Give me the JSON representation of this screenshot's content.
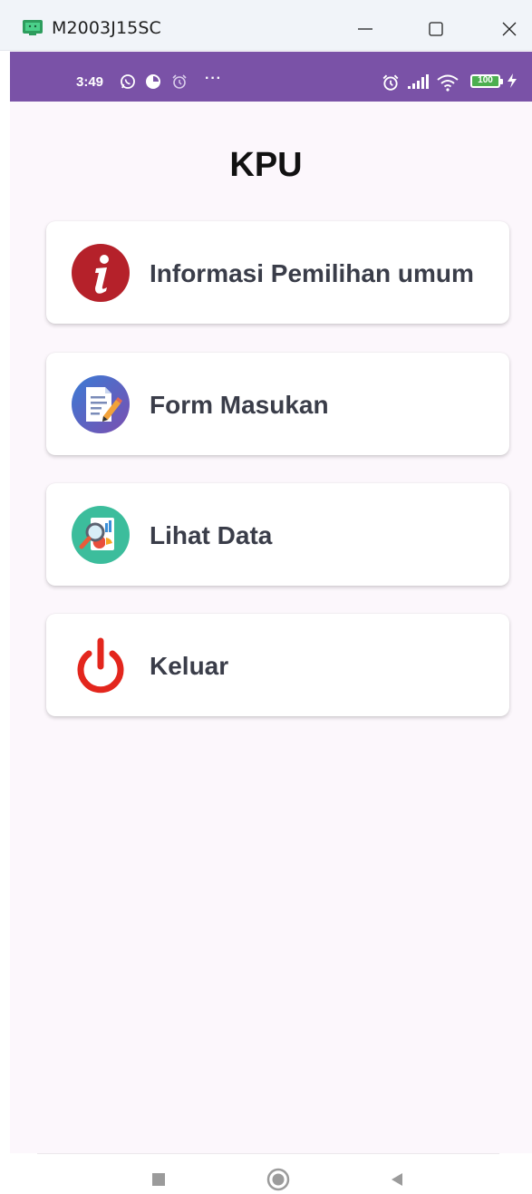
{
  "window": {
    "title": "M2003J15SC",
    "controls": [
      "minimize",
      "maximize",
      "close"
    ]
  },
  "status_bar": {
    "time": "3:49",
    "left_icons": [
      "whatsapp-icon",
      "app-notification-icon",
      "alarm-icon"
    ],
    "more": "···",
    "right_icons": [
      "alarm-icon",
      "signal-icon",
      "wifi-icon"
    ],
    "battery": "100",
    "charging": true,
    "background_color": "#7a52a7"
  },
  "app": {
    "title": "KPU",
    "background_color": "#fcf7fc",
    "menu": [
      {
        "label": "Informasi Pemilihan umum",
        "icon": "info-icon",
        "icon_color": "#b5212a"
      },
      {
        "label": "Form Masukan",
        "icon": "form-edit-icon",
        "icon_color": "#5a61b8"
      },
      {
        "label": "Lihat Data",
        "icon": "view-data-icon",
        "icon_color": "#3cbd9c"
      },
      {
        "label": "Keluar",
        "icon": "power-icon",
        "icon_color": "#e3261d"
      }
    ]
  },
  "nav_bar": {
    "buttons": [
      "recents-button",
      "home-button",
      "back-button"
    ]
  }
}
